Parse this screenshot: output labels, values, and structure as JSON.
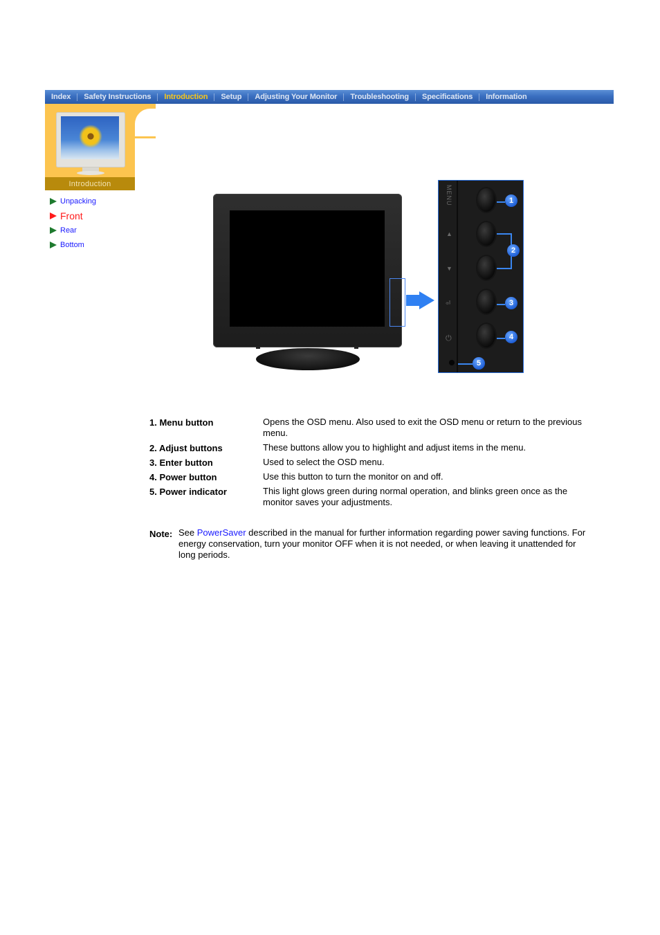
{
  "nav": {
    "items": [
      {
        "label": "Index"
      },
      {
        "label": "Safety Instructions"
      },
      {
        "label": "Introduction",
        "active": true
      },
      {
        "label": "Setup"
      },
      {
        "label": "Adjusting Your Monitor"
      },
      {
        "label": "Troubleshooting"
      },
      {
        "label": "Specifications"
      },
      {
        "label": "Information"
      }
    ],
    "active_color": "#f2c318",
    "bar_color": "#3a6fc0"
  },
  "side": {
    "section_label": "Introduction",
    "accent_color": "#fcc44f",
    "links": [
      {
        "label": "Unpacking"
      },
      {
        "label": "Front",
        "active": true
      },
      {
        "label": "Rear"
      },
      {
        "label": "Bottom"
      }
    ]
  },
  "figure": {
    "panel_labels": {
      "menu": "MENU",
      "up": "▲",
      "down": "▼",
      "enter": "⏎",
      "power": "⏻"
    },
    "callouts": [
      "1",
      "2",
      "3",
      "4",
      "5"
    ]
  },
  "descriptions": [
    {
      "term": "1. Menu button",
      "text": "Opens the OSD menu. Also used to exit the OSD menu or return to the previous menu."
    },
    {
      "term": "2. Adjust buttons",
      "text": "These buttons allow you to highlight and adjust items in the menu."
    },
    {
      "term": "3. Enter button",
      "text": "Used to select the OSD menu."
    },
    {
      "term": "4. Power button",
      "text": "Use this button to turn the monitor on and off."
    },
    {
      "term": "5. Power indicator",
      "text": "This light glows green during normal operation, and blinks green once as the monitor saves your adjustments."
    }
  ],
  "note": {
    "label": "Note:",
    "prefix": "See ",
    "link": "PowerSaver",
    "suffix": " described in the manual for further information regarding power saving functions. For energy conservation, turn your monitor OFF when it is not needed, or when leaving it unattended for long periods."
  }
}
